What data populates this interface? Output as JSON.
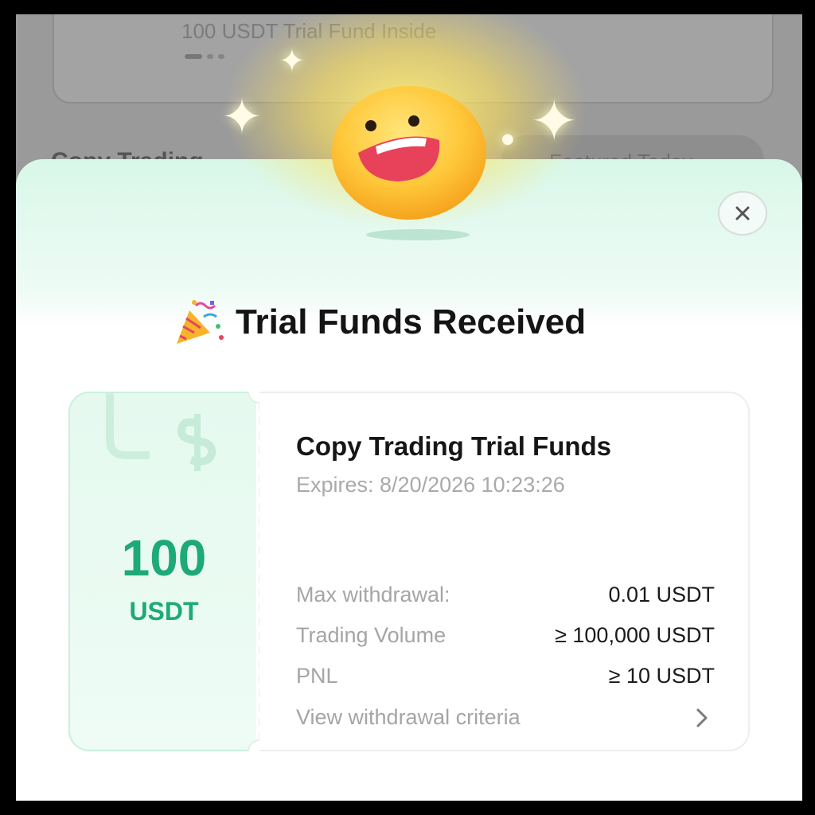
{
  "background": {
    "promo_text": "100 USDT Trial Fund Inside",
    "section_title": "Copy Trading",
    "pill_text": "Featured Today"
  },
  "modal": {
    "title": "Trial Funds Received",
    "close_icon": "close-icon",
    "party_icon": "party-popper-icon",
    "mascot_icon": "smiling-face-icon"
  },
  "ticket": {
    "amount": "100",
    "unit": "USDT",
    "title": "Copy Trading Trial Funds",
    "expires": "Expires: 8/20/2026 10:23:26",
    "rows": [
      {
        "label": "Max withdrawal:",
        "value": "0.01 USDT"
      },
      {
        "label": "Trading Volume",
        "value": "≥ 100,000 USDT"
      },
      {
        "label": "PNL",
        "value": "≥ 10 USDT"
      }
    ],
    "criteria_link": "View withdrawal criteria"
  },
  "colors": {
    "accent": "#1ea978",
    "modal_tint": "#d8f7e9",
    "title_text": "#141414"
  }
}
